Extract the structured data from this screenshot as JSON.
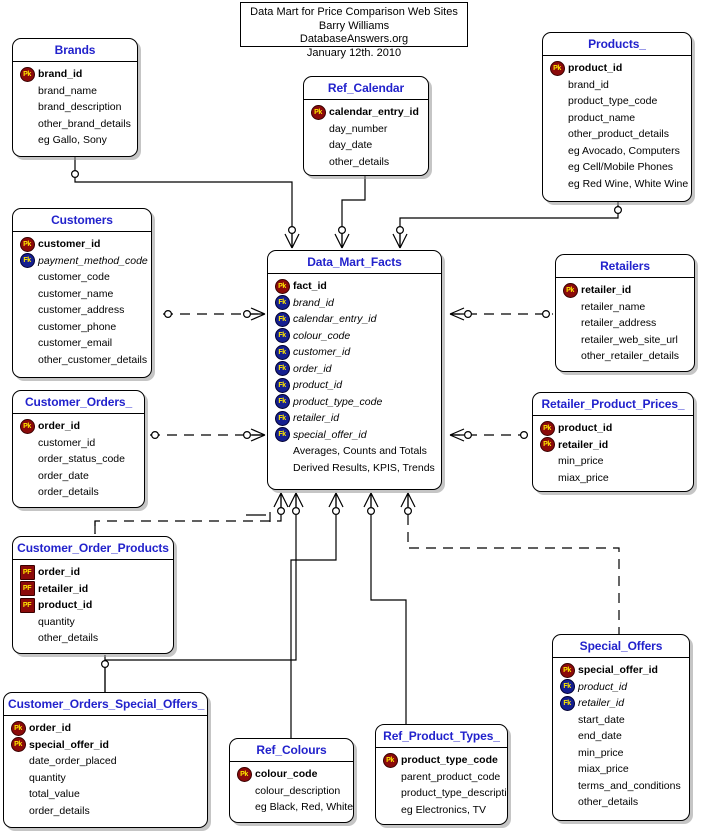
{
  "title_block": {
    "line1": "Data Mart for Price Comparison Web Sites",
    "line2": "Barry Williams",
    "line3": "DatabaseAnswers.org",
    "line4": "January 12th. 2010"
  },
  "legend": {
    "pk": "Pk",
    "fk": "Fk",
    "pf": "PF"
  },
  "entities": {
    "brands": {
      "name": "Brands",
      "attrs": [
        {
          "key": "Pk",
          "name": "brand_id"
        },
        {
          "key": "",
          "name": "brand_name"
        },
        {
          "key": "",
          "name": "brand_description"
        },
        {
          "key": "",
          "name": "other_brand_details"
        },
        {
          "key": "",
          "name": "eg Gallo, Sony"
        }
      ]
    },
    "ref_calendar": {
      "name": "Ref_Calendar",
      "attrs": [
        {
          "key": "Pk",
          "name": "calendar_entry_id"
        },
        {
          "key": "",
          "name": "day_number"
        },
        {
          "key": "",
          "name": "day_date"
        },
        {
          "key": "",
          "name": "other_details"
        }
      ]
    },
    "products": {
      "name": "Products_",
      "attrs": [
        {
          "key": "Pk",
          "name": "product_id"
        },
        {
          "key": "",
          "name": "brand_id"
        },
        {
          "key": "",
          "name": "product_type_code"
        },
        {
          "key": "",
          "name": "product_name"
        },
        {
          "key": "",
          "name": "other_product_details"
        },
        {
          "key": "",
          "name": "eg Avocado, Computers"
        },
        {
          "key": "",
          "name": "eg Cell/Mobile Phones"
        },
        {
          "key": "",
          "name": "eg Red Wine, White Wine"
        }
      ]
    },
    "customers": {
      "name": "Customers",
      "attrs": [
        {
          "key": "Pk",
          "name": "customer_id"
        },
        {
          "key": "Fk",
          "name": "payment_method_code"
        },
        {
          "key": "",
          "name": "customer_code"
        },
        {
          "key": "",
          "name": "customer_name"
        },
        {
          "key": "",
          "name": "customer_address"
        },
        {
          "key": "",
          "name": "customer_phone"
        },
        {
          "key": "",
          "name": "customer_email"
        },
        {
          "key": "",
          "name": "other_customer_details"
        }
      ]
    },
    "data_mart_facts": {
      "name": "Data_Mart_Facts",
      "attrs": [
        {
          "key": "Pk",
          "name": "fact_id"
        },
        {
          "key": "Fk",
          "name": "brand_id"
        },
        {
          "key": "Fk",
          "name": "calendar_entry_id"
        },
        {
          "key": "Fk",
          "name": "colour_code"
        },
        {
          "key": "Fk",
          "name": "customer_id"
        },
        {
          "key": "Fk",
          "name": "order_id"
        },
        {
          "key": "Fk",
          "name": "product_id"
        },
        {
          "key": "Fk",
          "name": "product_type_code"
        },
        {
          "key": "Fk",
          "name": "retailer_id"
        },
        {
          "key": "Fk",
          "name": "special_offer_id"
        },
        {
          "key": "",
          "name": "Averages, Counts and Totals"
        },
        {
          "key": "",
          "name": "Derived Results, KPIS, Trends"
        }
      ]
    },
    "retailers": {
      "name": "Retailers",
      "attrs": [
        {
          "key": "Pk",
          "name": "retailer_id"
        },
        {
          "key": "",
          "name": "retailer_name"
        },
        {
          "key": "",
          "name": "retailer_address"
        },
        {
          "key": "",
          "name": "retailer_web_site_url"
        },
        {
          "key": "",
          "name": "other_retailer_details"
        }
      ]
    },
    "customer_orders": {
      "name": "Customer_Orders_",
      "attrs": [
        {
          "key": "Pk",
          "name": "order_id"
        },
        {
          "key": "",
          "name": "customer_id"
        },
        {
          "key": "",
          "name": "order_status_code"
        },
        {
          "key": "",
          "name": "order_date"
        },
        {
          "key": "",
          "name": "order_details"
        }
      ]
    },
    "retailer_product_prices": {
      "name": "Retailer_Product_Prices_",
      "attrs": [
        {
          "key": "Pk",
          "name": "product_id"
        },
        {
          "key": "Pk",
          "name": "retailer_id"
        },
        {
          "key": "",
          "name": "min_price"
        },
        {
          "key": "",
          "name": "miax_price"
        }
      ]
    },
    "customer_order_products": {
      "name": "Customer_Order_Products",
      "attrs": [
        {
          "key": "PF",
          "name": "order_id"
        },
        {
          "key": "PF",
          "name": "retailer_id"
        },
        {
          "key": "PF",
          "name": "product_id"
        },
        {
          "key": "",
          "name": "quantity"
        },
        {
          "key": "",
          "name": "other_details"
        }
      ]
    },
    "special_offers": {
      "name": "Special_Offers",
      "attrs": [
        {
          "key": "Pk",
          "name": "special_offer_id"
        },
        {
          "key": "Fk",
          "name": "product_id"
        },
        {
          "key": "Fk",
          "name": "retailer_id"
        },
        {
          "key": "",
          "name": "start_date"
        },
        {
          "key": "",
          "name": "end_date"
        },
        {
          "key": "",
          "name": "min_price"
        },
        {
          "key": "",
          "name": "miax_price"
        },
        {
          "key": "",
          "name": "terms_and_conditions"
        },
        {
          "key": "",
          "name": "other_details"
        }
      ]
    },
    "customer_orders_special_offers": {
      "name": "Customer_Orders_Special_Offers_",
      "attrs": [
        {
          "key": "Pk",
          "name": "order_id"
        },
        {
          "key": "Pk",
          "name": "special_offer_id"
        },
        {
          "key": "",
          "name": "date_order_placed"
        },
        {
          "key": "",
          "name": "quantity"
        },
        {
          "key": "",
          "name": "total_value"
        },
        {
          "key": "",
          "name": "order_details"
        }
      ]
    },
    "ref_colours": {
      "name": "Ref_Colours",
      "attrs": [
        {
          "key": "Pk",
          "name": "colour_code"
        },
        {
          "key": "",
          "name": "colour_description"
        },
        {
          "key": "",
          "name": "eg Black, Red, White"
        }
      ]
    },
    "ref_product_types": {
      "name": "Ref_Product_Types_",
      "attrs": [
        {
          "key": "Pk",
          "name": "product_type_code"
        },
        {
          "key": "",
          "name": "parent_product_code"
        },
        {
          "key": "",
          "name": "product_type_description"
        },
        {
          "key": "",
          "name": "eg Electronics, TV"
        }
      ]
    }
  },
  "colors": {
    "entity_title": "#2222CC",
    "pk_badge": "#8B0A0A",
    "fk_badge": "#151F8F",
    "line": "#000000",
    "background": "#FFFFFF"
  }
}
